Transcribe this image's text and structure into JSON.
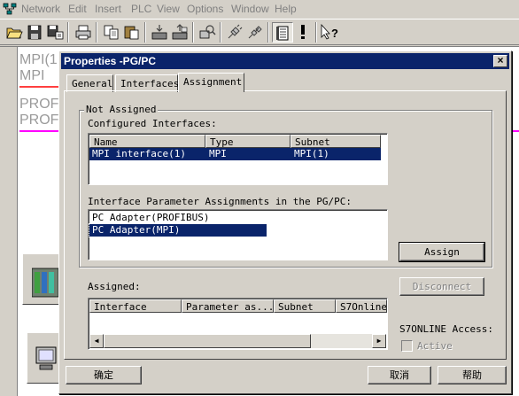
{
  "menubar": {
    "items": [
      "Network",
      "Edit",
      "Insert",
      "PLC",
      "View",
      "Options",
      "Window",
      "Help"
    ]
  },
  "background": {
    "labels": [
      "MPI(1",
      "MPI",
      "PROF",
      "PROF"
    ]
  },
  "dialog": {
    "title": "Properties -PG/PC",
    "close_label": "×",
    "tabs": [
      "General",
      "Interfaces",
      "Assignment"
    ],
    "active_tab": "Assignment",
    "not_assigned_group": "Not Assigned",
    "configured_label": "Configured Interfaces:",
    "configured_columns": [
      "Name",
      "Type",
      "Subnet"
    ],
    "configured_rows": [
      {
        "name": "MPI interface(1)",
        "type": "MPI",
        "subnet": "MPI(1)"
      }
    ],
    "param_label": "Interface Parameter Assignments in the PG/PC:",
    "param_items": [
      "PC Adapter(PROFIBUS)",
      "PC Adapter(MPI)"
    ],
    "assign_button": "Assign",
    "disconnect_button": "Disconnect",
    "assigned_label": "Assigned:",
    "assigned_columns": [
      "Interface",
      "Parameter as...",
      "Subnet",
      "S7Online"
    ],
    "s7online_label": "S7ONLINE Access:",
    "active_checkbox_label": "Active",
    "ok_button": "确定",
    "cancel_button": "取消",
    "help_button": "帮助"
  },
  "colors": {
    "face": "#d4d0c8",
    "titlebar": "#0a246a",
    "selection": "#0a246a",
    "magenta_line": "#ff00ff"
  }
}
